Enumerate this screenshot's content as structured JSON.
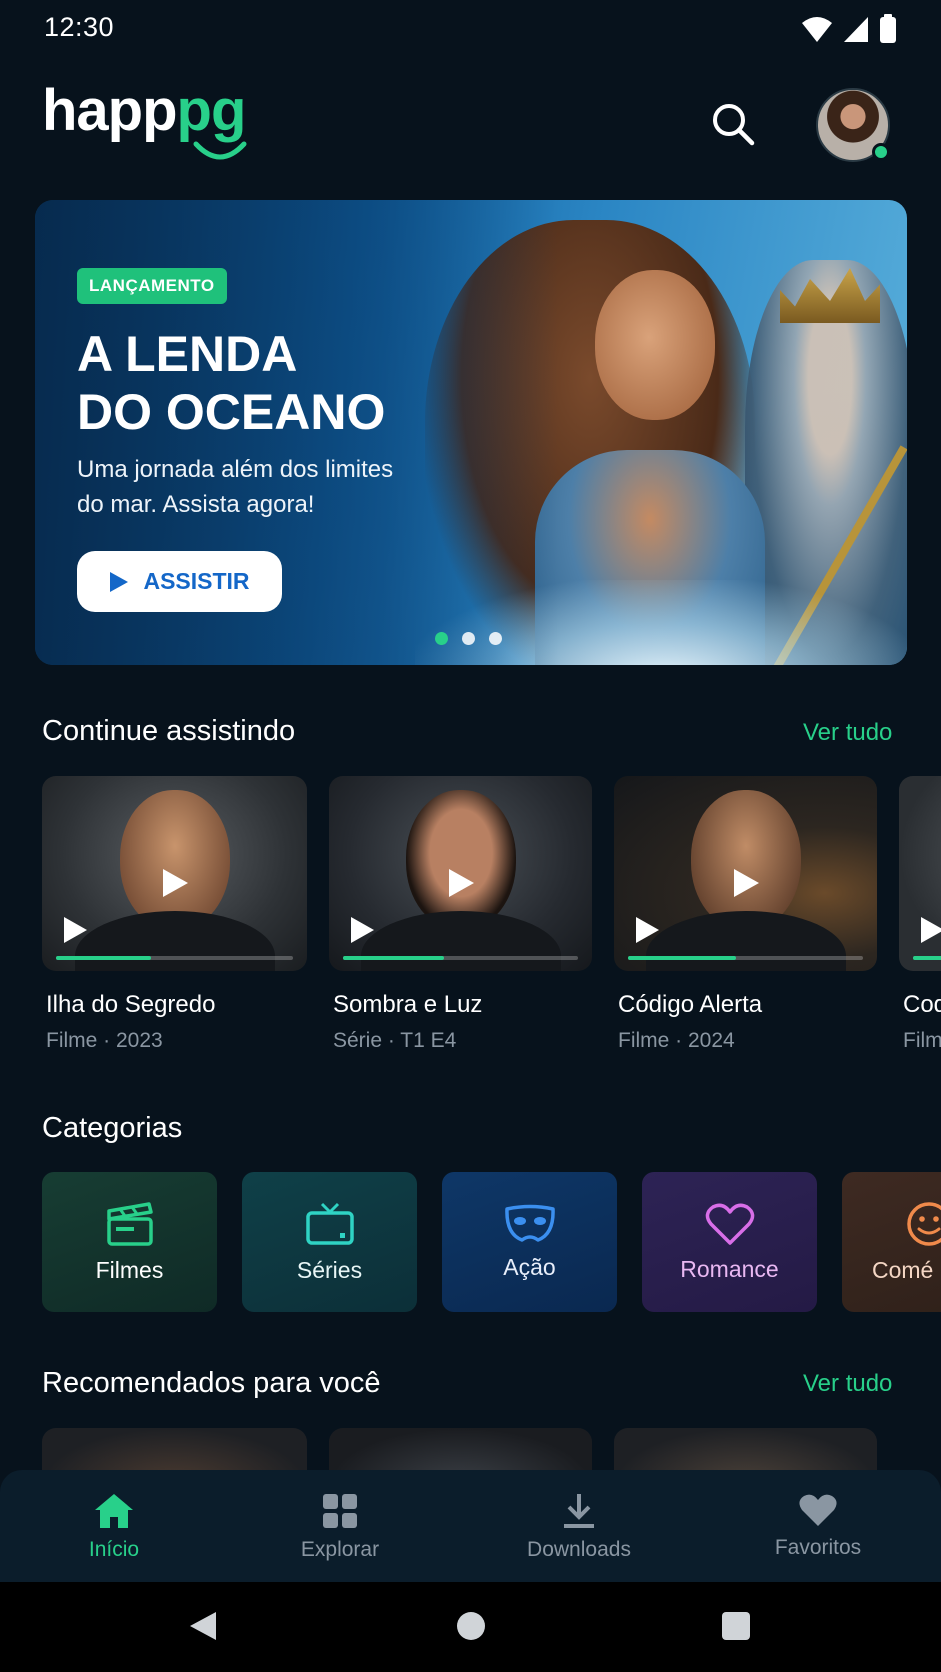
{
  "status_bar": {
    "time": "12:30"
  },
  "header": {
    "logo_main": "happ",
    "logo_accent": "pg"
  },
  "hero": {
    "badge": "LANÇAMENTO",
    "title_line1": "A LENDA",
    "title_line2": "DO OCEANO",
    "subtitle_line1": "Uma jornada além dos limites",
    "subtitle_line2": "do mar. Assista agora!",
    "button_label": "ASSISTIR",
    "carousel_pages": 3,
    "carousel_active": 0
  },
  "continue_watching": {
    "title": "Continue assistindo",
    "see_all": "Ver tudo",
    "items": [
      {
        "title": "Ilha do Segredo",
        "meta": "Filme · 2023",
        "progress": 0.4
      },
      {
        "title": "Sombra e Luz",
        "meta": "Série · T1 E4",
        "progress": 0.43
      },
      {
        "title": "Código Alerta",
        "meta": "Filme · 2024",
        "progress": 0.46
      },
      {
        "title": "Cod",
        "meta": "Film",
        "progress": 0.5
      }
    ]
  },
  "categories": {
    "title": "Categorias",
    "items": [
      {
        "label": "Filmes",
        "icon": "clapperboard-icon",
        "color": "#28d08a"
      },
      {
        "label": "Séries",
        "icon": "tv-icon",
        "color": "#2fd3c4"
      },
      {
        "label": "Ação",
        "icon": "mask-icon",
        "color": "#3b8fef"
      },
      {
        "label": "Romance",
        "icon": "heart-icon",
        "color": "#d86ee8"
      },
      {
        "label": "Comé",
        "icon": "smiley-icon",
        "color": "#f08a4b"
      }
    ]
  },
  "recommended": {
    "title": "Recomendados para você",
    "see_all": "Ver tudo"
  },
  "bottom_nav": {
    "items": [
      {
        "label": "Início",
        "icon": "home-icon",
        "active": true
      },
      {
        "label": "Explorar",
        "icon": "grid-icon",
        "active": false
      },
      {
        "label": "Downloads",
        "icon": "download-icon",
        "active": false
      },
      {
        "label": "Favoritos",
        "icon": "heart-icon",
        "active": false
      }
    ]
  },
  "colors": {
    "accent": "#28d08a",
    "background": "#07121c",
    "nav_background": "#0b1d2b",
    "button_text": "#1467c8"
  }
}
